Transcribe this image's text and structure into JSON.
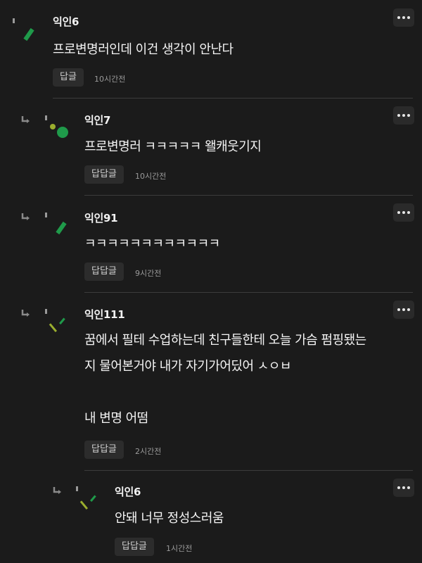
{
  "comments": [
    {
      "name": "익인6",
      "body": "프로변명러인데 이건 생각이 안난다",
      "reply_label": "답글",
      "time": "10시간전"
    },
    {
      "name": "익인7",
      "body": "프로변명러 ㅋㅋㅋㅋㅋ 왤캐웃기지",
      "reply_label": "답답글",
      "time": "10시간전"
    },
    {
      "name": "익인91",
      "body": "ㅋㅋㅋㅋㅋㅋㅋㅋㅋㅋㅋㅋ",
      "reply_label": "답답글",
      "time": "9시간전"
    },
    {
      "name": "익인111",
      "body": "꿈에서 필테 수업하는데 친구들한테 오늘 가슴 펌핑됐는\n지 물어본거야 내가 자기가어딨어 ㅅㅇㅂ\n\n내 변명 어떰",
      "reply_label": "답답글",
      "time": "2시간전"
    },
    {
      "name": "익인6",
      "body": "안돼 너무 정성스러움",
      "reply_label": "답답글",
      "time": "1시간전"
    }
  ],
  "icons": {
    "reply": "reply-arrow-icon",
    "more": "more-dots-icon",
    "avatar": "anonymous-avatar-icon"
  },
  "colors": {
    "background": "#1b1b1b",
    "button_bg": "#2c2c2c",
    "avatar_green": "#1f9a4a",
    "avatar_yellow": "#9aae2e"
  }
}
